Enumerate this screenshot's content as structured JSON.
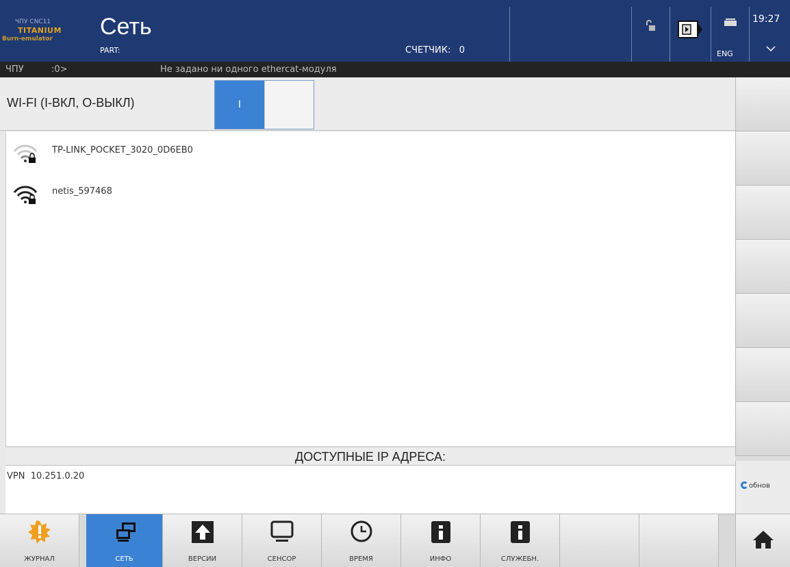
{
  "header": {
    "brand_line1": "ЧПУ CNC11",
    "brand_line2": "TITANIUM",
    "brand_line3": "Burn-emulator",
    "title": "Сеть",
    "part_label": "PART:",
    "counter_label": "СЧЕТЧИК:",
    "counter_value": "0",
    "time": "19:27",
    "language": "ENG"
  },
  "status_bar": {
    "mode": "ЧПУ",
    "value": ":0>",
    "message": "Не задано ни одного ethercat-модуля"
  },
  "wifi": {
    "label": "WI-FI (I-ВКЛ, О-ВЫКЛ)",
    "toggle_on_label": "I",
    "state": "on",
    "networks": [
      {
        "ssid": "TP-LINK_POCKET_3020_0D6EB0",
        "icon": "wifi-lock-icon",
        "signal": "weak"
      },
      {
        "ssid": "netis_597468",
        "icon": "wifi-lock-icon",
        "signal": "strong"
      }
    ]
  },
  "ip_section": {
    "header": "ДОСТУПНЫЕ IP АДРЕСА:",
    "rows": [
      "VPN  10.251.0.20"
    ]
  },
  "side": {
    "refresh_label": "обнов"
  },
  "tabs": [
    {
      "label": "ЖУРНАЛ",
      "icon": "journal-icon"
    },
    {
      "label": "СЕТЬ",
      "icon": "network-icon",
      "active": true
    },
    {
      "label": "ВЕРСИИ",
      "icon": "upload-icon"
    },
    {
      "label": "СЕНСОР",
      "icon": "monitor-icon"
    },
    {
      "label": "ВРЕМЯ",
      "icon": "clock-icon"
    },
    {
      "label": "ИНФО",
      "icon": "info-icon"
    },
    {
      "label": "СЛУЖЕБН.",
      "icon": "info-icon"
    }
  ],
  "colors": {
    "header_bg": "#1f3a73",
    "accent": "#3b82d4",
    "brand_orange": "#e3a21a"
  }
}
